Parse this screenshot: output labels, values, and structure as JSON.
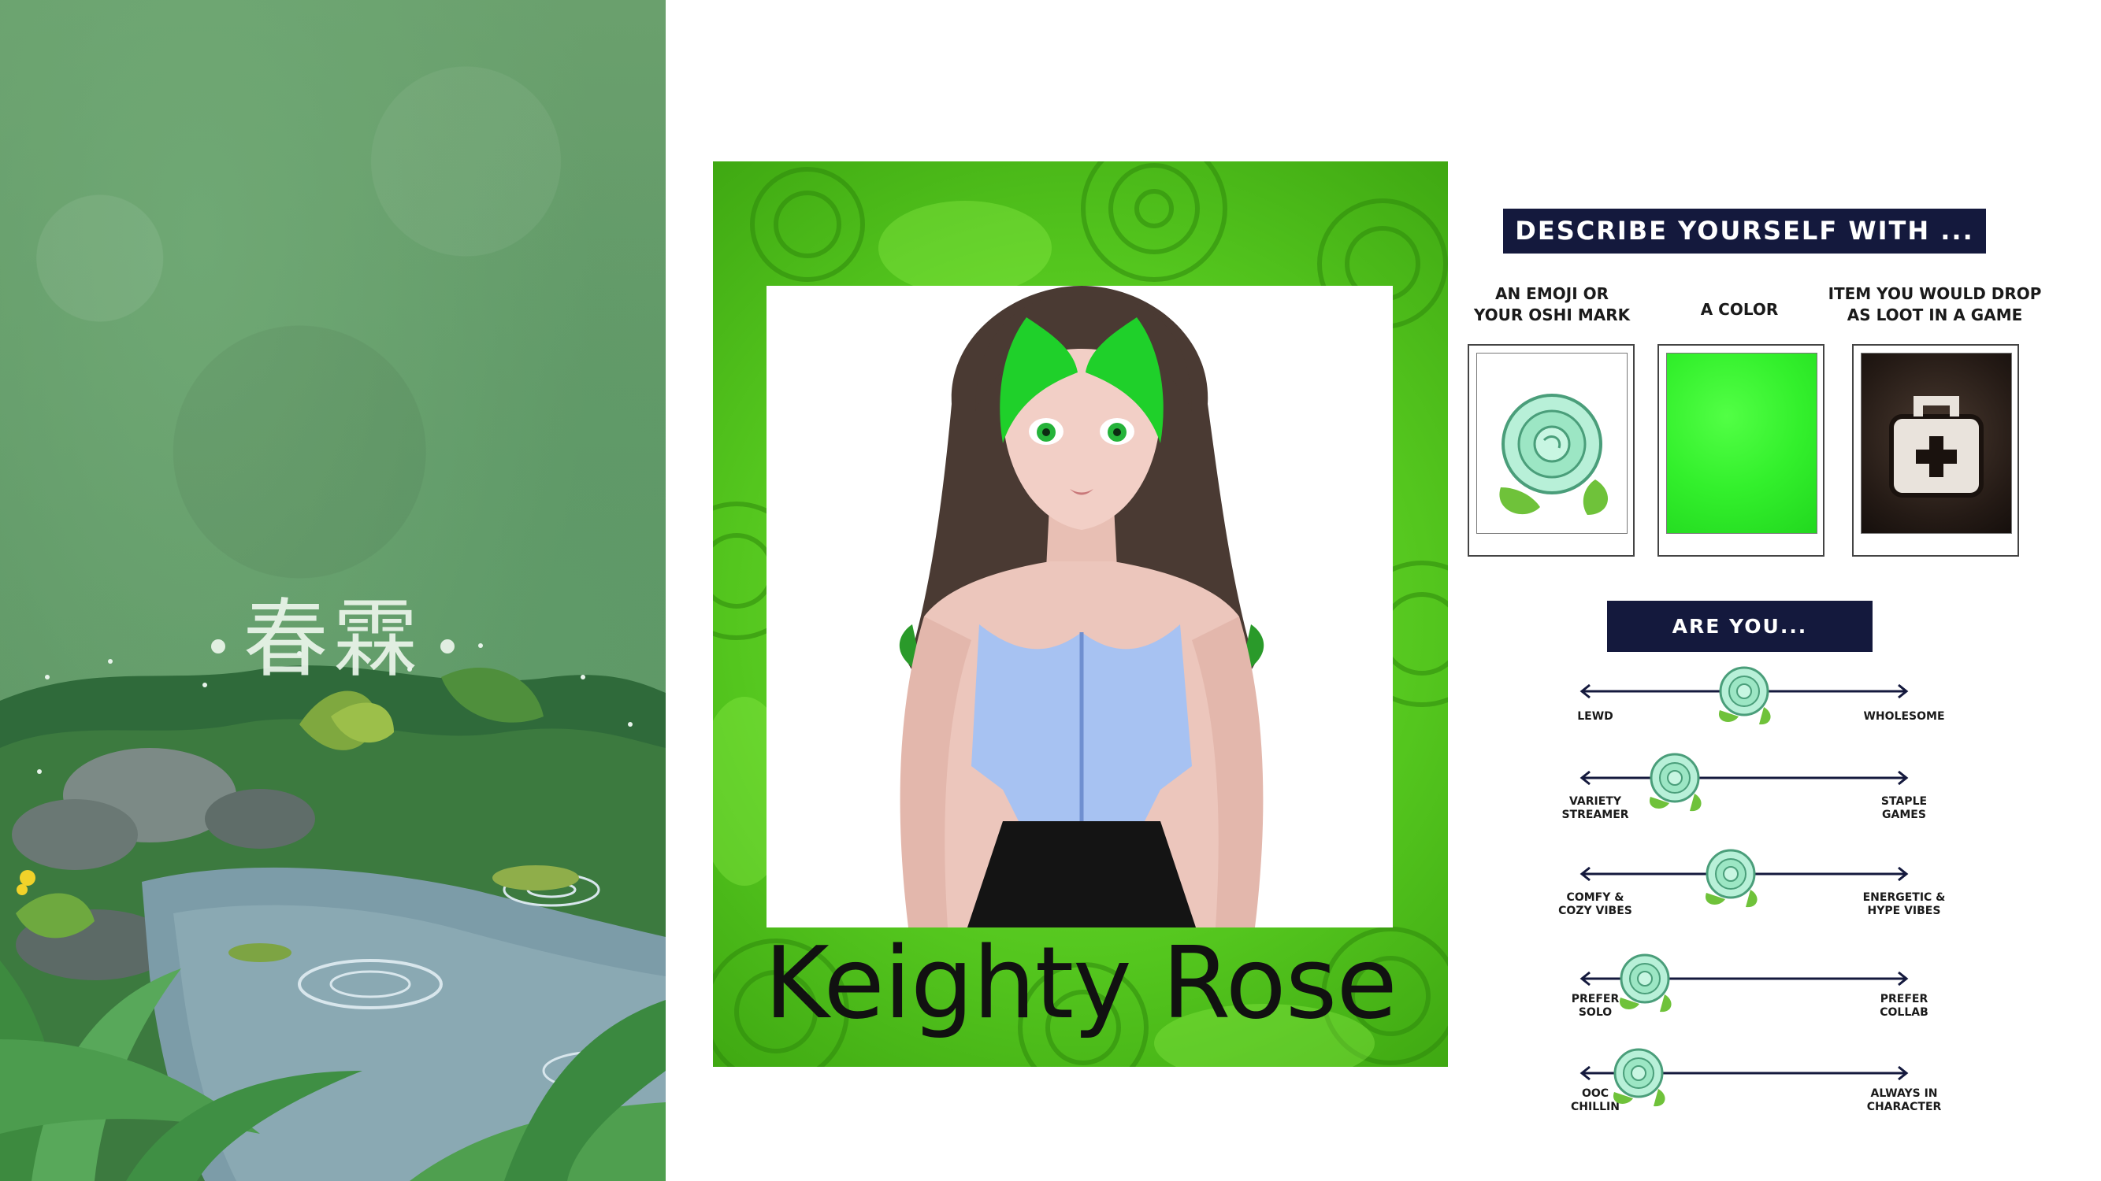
{
  "decor": {
    "kanji": "春霖"
  },
  "card": {
    "name": "Keighty Rose",
    "colors": {
      "rose_green": "#58c922",
      "portrait_bg": "#ffffff"
    }
  },
  "describe": {
    "title": "DESCRIBE YOURSELF WITH ...",
    "questions": [
      {
        "label_line1": "AN EMOJI OR",
        "label_line2": "YOUR OSHI MARK",
        "icon": "rose-emoji-icon"
      },
      {
        "label_line1": "A COLOR",
        "label_line2": "",
        "color": "#35f52c"
      },
      {
        "label_line1": "ITEM YOU WOULD DROP",
        "label_line2": "AS LOOT IN A GAME",
        "icon": "medkit-icon"
      }
    ]
  },
  "are_you": {
    "title": "ARE YOU...",
    "sliders": [
      {
        "left_line1": "LEWD",
        "left_line2": "",
        "right_line1": "WHOLESOME",
        "right_line2": "",
        "value": 0.5
      },
      {
        "left_line1": "VARIETY",
        "left_line2": "STREAMER",
        "right_line1": "STAPLE",
        "right_line2": "GAMES",
        "value": 0.29
      },
      {
        "left_line1": "COMFY &",
        "left_line2": "COZY VIBES",
        "right_line1": "ENERGETIC &",
        "right_line2": "HYPE VIBES",
        "value": 0.46
      },
      {
        "left_line1": "PREFER",
        "left_line2": "SOLO",
        "right_line1": "PREFER",
        "right_line2": "COLLAB",
        "value": 0.2
      },
      {
        "left_line1": "OOC",
        "left_line2": "CHILLIN",
        "right_line1": "ALWAYS IN",
        "right_line2": "CHARACTER",
        "value": 0.18
      }
    ],
    "colors": {
      "line": "#14193d"
    }
  }
}
